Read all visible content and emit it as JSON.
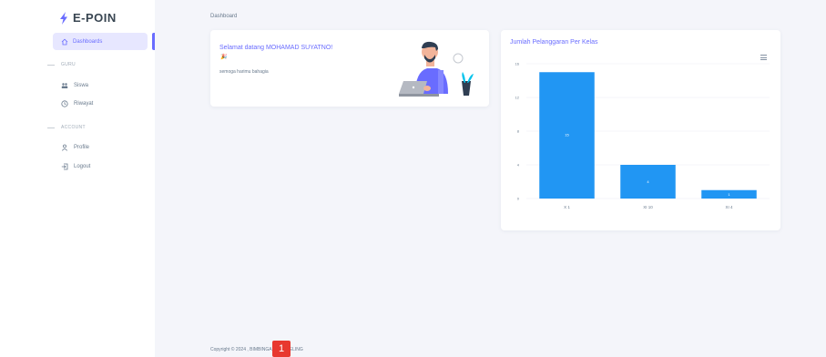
{
  "brand": {
    "name": "E-POIN",
    "accent": "#696cff"
  },
  "sidebar": {
    "active": {
      "label": "Dashboards",
      "icon": "home-icon"
    },
    "sections": [
      {
        "title": "GURU",
        "items": [
          {
            "label": "Siswa",
            "icon": "users-icon"
          },
          {
            "label": "Riwayat",
            "icon": "history-icon"
          }
        ]
      },
      {
        "title": "ACCOUNT",
        "items": [
          {
            "label": "Profile",
            "icon": "user-icon"
          },
          {
            "label": "Logout",
            "icon": "logout-icon"
          }
        ]
      }
    ]
  },
  "breadcrumb": "Dashboard",
  "welcome": {
    "title": "Selamat datang MOHAMAD SUYATNO!",
    "emoji": "🎉",
    "subtitle": "semoga harimu bahagia"
  },
  "chart": {
    "title": "Jumlah Pelanggaran Per Kelas",
    "menu_icon": "hamburger-icon",
    "bar_color": "#2196f3"
  },
  "chart_data": {
    "type": "bar",
    "title": "Jumlah Pelanggaran Per Kelas",
    "categories": [
      "X 1",
      "XI 10",
      "XI 4"
    ],
    "values": [
      15,
      4,
      1
    ],
    "ylim": [
      0,
      16
    ],
    "yticks": [
      0,
      4,
      8,
      12,
      16
    ],
    "grid": true
  },
  "footer": {
    "text": "Copyright © 2024 , BIMBINGAN KONSELING"
  },
  "badge": {
    "label": "1",
    "color": "#e8382f"
  }
}
